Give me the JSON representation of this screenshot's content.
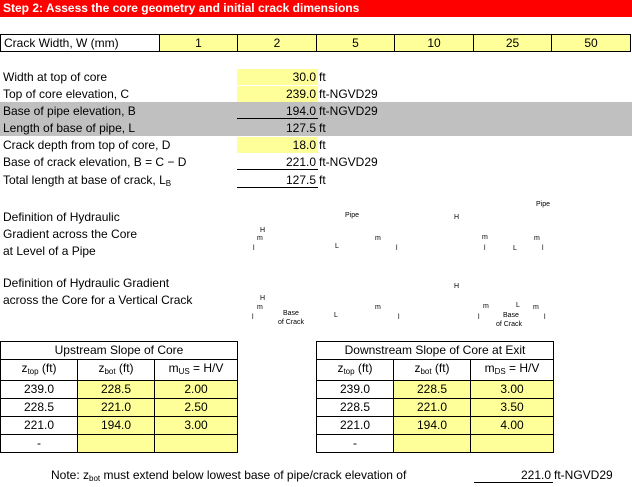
{
  "banner": "Step 2: Assess the core geometry and initial crack dimensions",
  "crack_width": {
    "label": "Crack Width, W (mm)",
    "values": [
      "1",
      "2",
      "5",
      "10",
      "25",
      "50"
    ]
  },
  "geometry": [
    {
      "label": "Width at top of core",
      "value": "30.0",
      "unit": "ft"
    },
    {
      "label": "Top of core elevation, C",
      "value": "239.0",
      "unit": "ft-NGVD29"
    },
    {
      "label": "Base of pipe elevation, B",
      "value": "194.0",
      "unit": "ft-NGVD29"
    },
    {
      "label": "Length of base of pipe, L",
      "value": "127.5",
      "unit": "ft"
    },
    {
      "label": "Crack depth from top of core, D",
      "value": "18.0",
      "unit": "ft"
    },
    {
      "label": "Base of crack elevation, B = C − D",
      "value": "221.0",
      "unit": "ft-NGVD29"
    },
    {
      "label_main": "Total length at base of crack, L",
      "label_sub": "B",
      "value": "127.5",
      "unit": "ft"
    }
  ],
  "definition_pipe": {
    "lines": [
      "Definition of Hydraulic",
      "Gradient across the Core",
      "at Level of a Pipe"
    ],
    "diagram_text": {
      "pipe1": "Pipe",
      "pipe2": "Pipe",
      "h1": "H",
      "h2": "H",
      "m": "m",
      "l": "l",
      "L": "L"
    }
  },
  "definition_crack": {
    "lines": [
      "Definition of Hydraulic Gradient",
      "across the Core for a Vertical Crack"
    ],
    "diagram_text": {
      "h1": "H",
      "h2": "H",
      "m": "m",
      "l": "l",
      "L": "L",
      "base_of_crack": [
        "Base",
        "of Crack"
      ]
    }
  },
  "upstream": {
    "title": "Upstream Slope of Core",
    "headers": {
      "ztop": "z",
      "ztop_sub": "top",
      "ztop_unit": " (ft)",
      "zbot": "z",
      "zbot_sub": "bot",
      "zbot_unit": " (ft)",
      "m": "m",
      "m_sub": "US",
      "m_unit": " = H/V"
    },
    "rows": [
      [
        "239.0",
        "228.5",
        "2.00"
      ],
      [
        "228.5",
        "221.0",
        "2.50"
      ],
      [
        "221.0",
        "194.0",
        "3.00"
      ],
      [
        "-",
        "",
        ""
      ]
    ]
  },
  "downstream": {
    "title": "Downstream Slope of Core at Exit",
    "headers": {
      "ztop": "z",
      "ztop_sub": "top",
      "ztop_unit": " (ft)",
      "zbot": "z",
      "zbot_sub": "bot",
      "zbot_unit": " (ft)",
      "m": "m",
      "m_sub": "DS",
      "m_unit": " = H/V"
    },
    "rows": [
      [
        "239.0",
        "228.5",
        "3.00"
      ],
      [
        "228.5",
        "221.0",
        "3.50"
      ],
      [
        "221.0",
        "194.0",
        "4.00"
      ],
      [
        "-",
        "",
        ""
      ]
    ]
  },
  "note": {
    "prefix": "Note:  z",
    "sub": "bot",
    "suffix": " must extend below lowest base of pipe/crack elevation of",
    "value": "221.0",
    "unit": "ft-NGVD29"
  }
}
